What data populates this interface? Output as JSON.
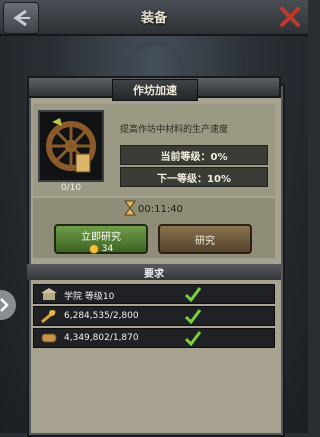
{
  "topbar": {
    "title": "装备"
  },
  "panel": {
    "title": "作坊加速",
    "description": "提高作坊中材料的生产速度",
    "level_count": "0/10",
    "current_level": "当前等级：0%",
    "next_level": "下一等级：10%"
  },
  "timer": {
    "value": "00:11:40"
  },
  "buttons": {
    "instant_label": "立即研究",
    "instant_cost": "34",
    "research_label": "研究"
  },
  "requirements": {
    "title": "要求",
    "items": [
      {
        "text": "学院 等级10",
        "icon": "academy-icon",
        "met": true
      },
      {
        "text": "6,284,535/2,800",
        "icon": "wheat-icon",
        "met": true
      },
      {
        "text": "4,349,802/1,870",
        "icon": "wood-icon",
        "met": true
      }
    ]
  },
  "colors": {
    "check": "#7bd13b",
    "close": "#c0392b"
  }
}
